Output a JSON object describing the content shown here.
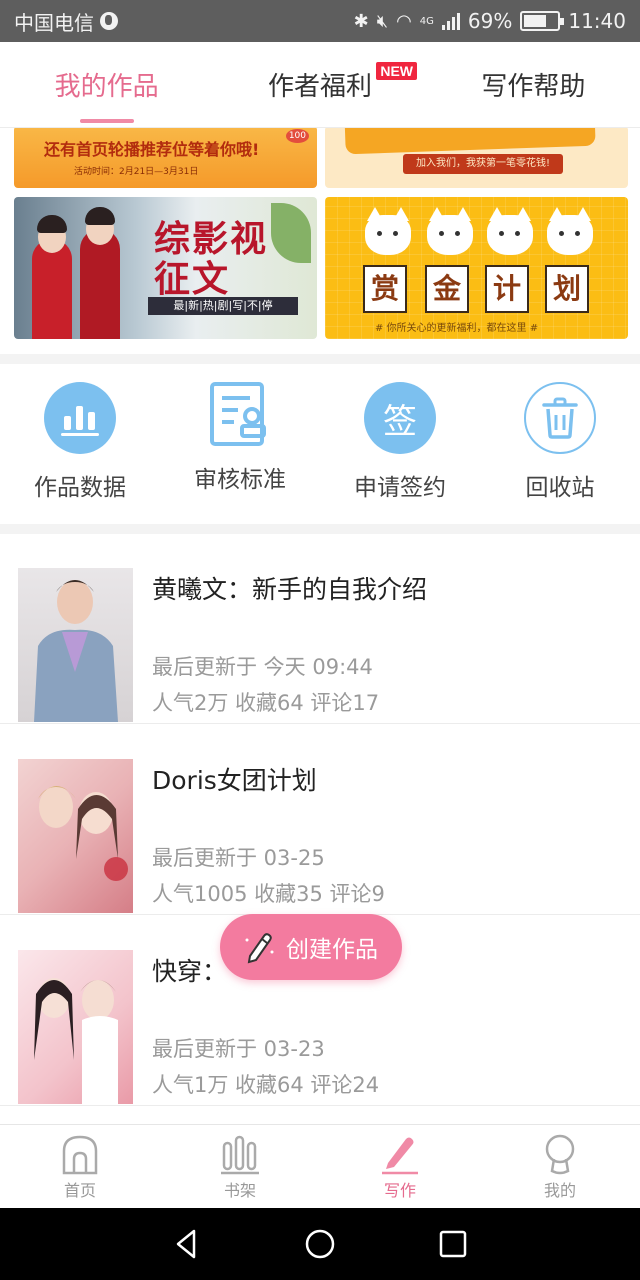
{
  "status_bar": {
    "carrier": "中国电信",
    "network": "4G",
    "battery": "69%",
    "time": "11:40"
  },
  "tabs": [
    {
      "label": "我的作品",
      "active": true
    },
    {
      "label": "作者福利",
      "badge": "NEW"
    },
    {
      "label": "写作帮助"
    }
  ],
  "banners": {
    "b1_text": "还有首页轮播推荐位等着你哦!",
    "b1_date": "活动时间：2月21日—3月31日",
    "b1_tag": "100",
    "b2_text": "加入我们，我获第一笔零花钱!",
    "b3_title": "综影视征文",
    "b3_sub": "最|新|热|剧|写|不|停",
    "b4_chars": [
      "赏",
      "金",
      "计",
      "划"
    ],
    "b4_note": "# 你所关心的更新福利，都在这里 #"
  },
  "quick_actions": [
    {
      "label": "作品数据",
      "icon": "bar-chart-icon"
    },
    {
      "label": "审核标准",
      "icon": "checklist-icon"
    },
    {
      "label": "申请签约",
      "icon": "sign-icon",
      "icon_text": "签"
    },
    {
      "label": "回收站",
      "icon": "trash-icon"
    }
  ],
  "works": [
    {
      "title": "黄曦文：新手的自我介绍",
      "updated": "最后更新于 今天 09:44",
      "stats": "人气2万  收藏64  评论17"
    },
    {
      "title": "Doris女团计划",
      "updated": "最后更新于 03-25",
      "stats": "人气1005  收藏35  评论9"
    },
    {
      "title": "快穿：",
      "updated": "最后更新于 03-23",
      "stats": "人气1万  收藏64  评论24"
    }
  ],
  "fab": {
    "label": "创建作品"
  },
  "bottom_nav": [
    {
      "label": "首页",
      "icon": "home-icon"
    },
    {
      "label": "书架",
      "icon": "bookshelf-icon"
    },
    {
      "label": "写作",
      "icon": "pen-icon",
      "active": true
    },
    {
      "label": "我的",
      "icon": "profile-icon"
    }
  ],
  "colors": {
    "accent": "#e56b8e",
    "fab": "#f37b9f",
    "icon_blue": "#7cc0ef",
    "muted_text": "#9a9a9a"
  }
}
